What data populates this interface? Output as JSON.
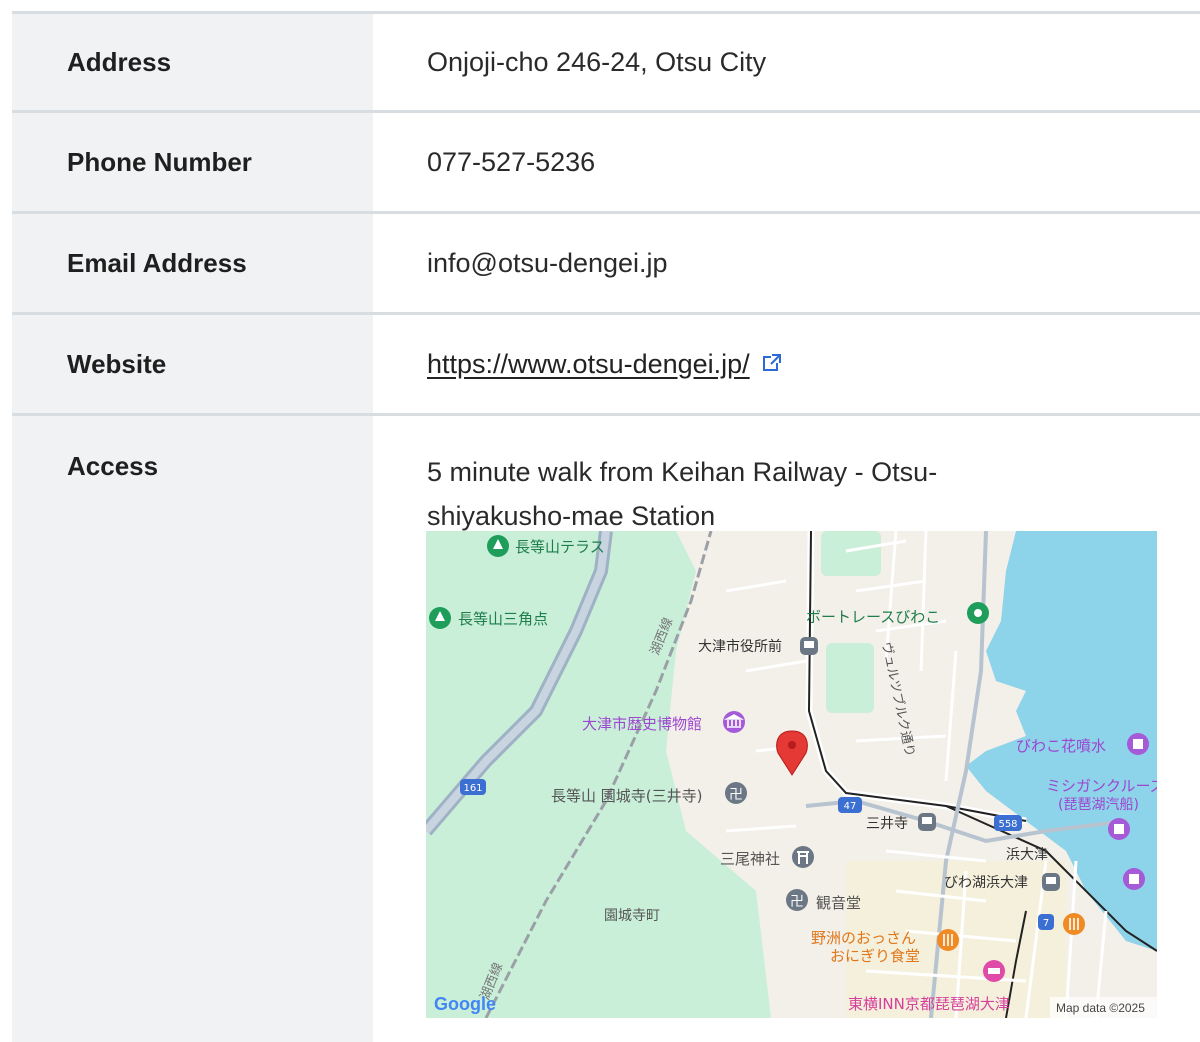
{
  "rows": [
    {
      "label": "Address",
      "value": "Onjoji-cho 246-24, Otsu City"
    },
    {
      "label": "Phone Number",
      "value": "077-527-5236"
    },
    {
      "label": "Email Address",
      "value": "info@otsu-dengei.jp"
    },
    {
      "label": "Website",
      "value": "https://www.otsu-dengei.jp/"
    },
    {
      "label": "Access",
      "value": "5 minute walk from Keihan Railway - Otsu-shiyakusho-mae Station"
    }
  ],
  "map": {
    "places": {
      "p1": "長等山テラス",
      "p2": "長等山三角点",
      "p3": "ボートレースびわこ",
      "p4": "大津市役所前",
      "p5": "大津市歴史博物館",
      "p6": "びわこ花噴水",
      "p7": "ミシガンクルーズ",
      "p7b": "(琵琶湖汽船)",
      "p8": "長等山 園城寺(三井寺)",
      "p9": "三井寺",
      "p10": "三尾神社",
      "p11": "浜大津",
      "p12": "びわ湖浜大津",
      "p13": "観音堂",
      "p14": "園城寺町",
      "p15": "野洲のおっさん",
      "p15b": "おにぎり食堂",
      "p16": "東横INN京都琵琶湖大津",
      "road1": "湖西線",
      "road2": "湖西線",
      "road3": "ヴュルツブルク通り",
      "r161": "161",
      "r47": "47",
      "r558": "558",
      "r7": "7"
    },
    "logo": "Google",
    "attribution": "Map data ©2025",
    "colors": {
      "pin": "#e53935",
      "water": "#8dd3ea",
      "park": "#c9efd9",
      "poi_green": "#1e9e5a",
      "poi_purple": "#a55ad8",
      "poi_gray": "#6b7785",
      "poi_orange": "#f08a24",
      "poi_pink": "#e04ba8"
    },
    "icons": [
      "park-icon",
      "museum-icon",
      "temple-icon",
      "shrine-icon",
      "station-icon",
      "restaurant-icon",
      "hotel-icon",
      "attraction-icon",
      "map-pin-icon"
    ]
  }
}
